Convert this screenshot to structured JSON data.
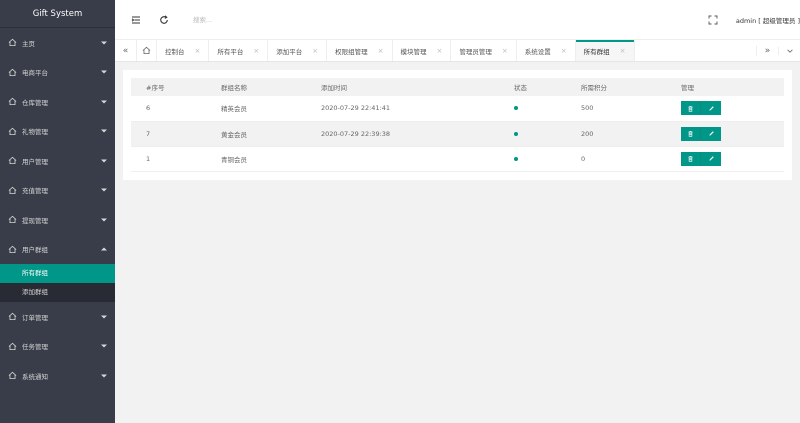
{
  "app": {
    "title": "Gift System"
  },
  "sidebar": {
    "items": [
      {
        "label": "主页"
      },
      {
        "label": "电商平台"
      },
      {
        "label": "仓库管理"
      },
      {
        "label": "礼物管理"
      },
      {
        "label": "用户管理"
      },
      {
        "label": "充值管理"
      },
      {
        "label": "提现管理"
      },
      {
        "label": "用户群组",
        "open": true,
        "children": [
          {
            "label": "所有群组",
            "active": true
          },
          {
            "label": "添加群组"
          }
        ]
      },
      {
        "label": "订单管理"
      },
      {
        "label": "任务管理"
      },
      {
        "label": "系统通知"
      }
    ]
  },
  "header": {
    "search_placeholder": "搜索...",
    "user": "admin [ 超级管理员 ]"
  },
  "tabs": {
    "items": [
      {
        "label": "控制台"
      },
      {
        "label": "所有平台"
      },
      {
        "label": "添加平台"
      },
      {
        "label": "权限组管理"
      },
      {
        "label": "模块管理"
      },
      {
        "label": "管理员管理"
      },
      {
        "label": "系统设置"
      },
      {
        "label": "所有群组",
        "active": true
      }
    ],
    "close_glyph": "×",
    "prev_glyph": "«",
    "next_glyph": "»"
  },
  "table": {
    "headers": [
      "#序号",
      "群组名称",
      "添加时间",
      "状态",
      "所需积分",
      "管理"
    ],
    "rows": [
      {
        "id": "6",
        "name": "精英会员",
        "time": "2020-07-29 22:41:41",
        "points": "500"
      },
      {
        "id": "7",
        "name": "黄金会员",
        "time": "2020-07-29 22:39:38",
        "points": "200"
      },
      {
        "id": "1",
        "name": "青铜会员",
        "time": "",
        "points": "0"
      }
    ]
  },
  "colors": {
    "accent": "#009688",
    "sidebar_bg": "#393d49",
    "submenu_bg": "#282b33"
  }
}
